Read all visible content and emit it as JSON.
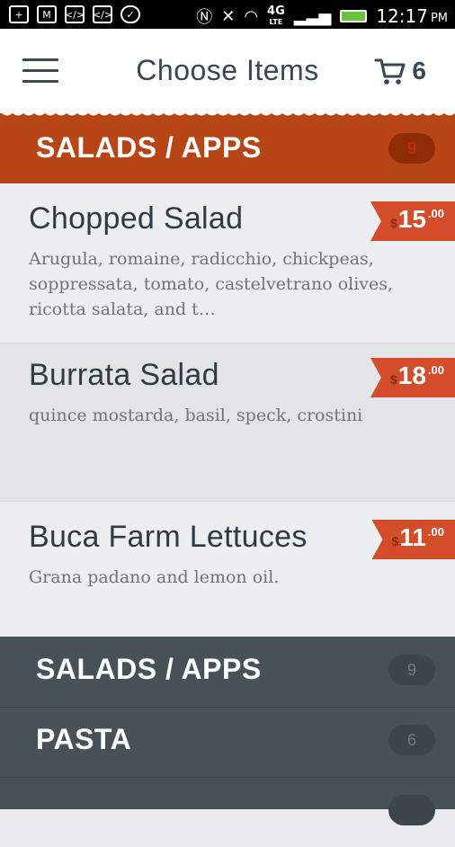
{
  "status_bar": {
    "time": "12:17",
    "ampm": "PM",
    "network": "4G",
    "network_sub": "LTE",
    "notification_icons": [
      "plus-box-icon",
      "gmail-icon",
      "code-icon",
      "code-icon",
      "chat-bubble-icon"
    ],
    "system_icons": [
      "nfc-icon",
      "mute-icon",
      "wifi-icon",
      "signal-icon",
      "battery-charging-icon"
    ]
  },
  "header": {
    "title": "Choose Items",
    "cart_count": "6"
  },
  "active_category": {
    "label": "SALADS / APPS",
    "count": "9"
  },
  "items": [
    {
      "name": "Chopped Salad",
      "description": "Arugula, romaine, radicchio, chickpeas, soppressata, tomato, castelvetrano olives, ricotta salata, and t…",
      "currency": "$",
      "price": "15",
      "cents": ".00"
    },
    {
      "name": "Burrata Salad",
      "description": "quince mostarda, basil, speck, crostini",
      "currency": "$",
      "price": "18",
      "cents": ".00"
    },
    {
      "name": "Buca Farm Lettuces",
      "description": "Grana padano and lemon oil.",
      "currency": "$",
      "price": "11",
      "cents": ".00"
    }
  ],
  "categories": [
    {
      "label": "SALADS / APPS",
      "count": "9"
    },
    {
      "label": "PASTA",
      "count": "6"
    }
  ],
  "colors": {
    "accent": "#b84516",
    "price_tag": "#d34d2a",
    "dark_panel": "#475158",
    "text_dark": "#2f3b44"
  }
}
